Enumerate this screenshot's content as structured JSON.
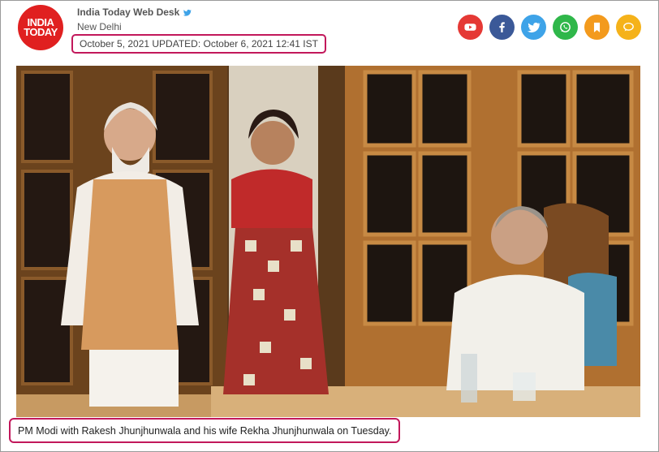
{
  "header": {
    "logo_line1": "INDIA",
    "logo_line2": "TODAY",
    "author": "India Today Web Desk",
    "location": "New Delhi",
    "dateline": "October 5, 2021  UPDATED: October 6, 2021 12:41 IST"
  },
  "share_buttons": [
    {
      "name": "youtube",
      "icon": "play-icon",
      "color": "#e53935"
    },
    {
      "name": "facebook",
      "icon": "facebook-icon",
      "color": "#3b5998"
    },
    {
      "name": "twitter",
      "icon": "twitter-icon",
      "color": "#3ea3e8"
    },
    {
      "name": "whatsapp",
      "icon": "whatsapp-icon",
      "color": "#2fb74a"
    },
    {
      "name": "bookmark",
      "icon": "bookmark-icon",
      "color": "#f39a1d"
    },
    {
      "name": "comment",
      "icon": "comment-icon",
      "color": "#f5b21a"
    }
  ],
  "photo": {
    "caption": "PM Modi with Rakesh Jhunjhunwala and his wife Rekha Jhunjhunwala on Tuesday."
  },
  "colors": {
    "brand_red": "#e02020",
    "highlight_border": "#c2185b"
  }
}
